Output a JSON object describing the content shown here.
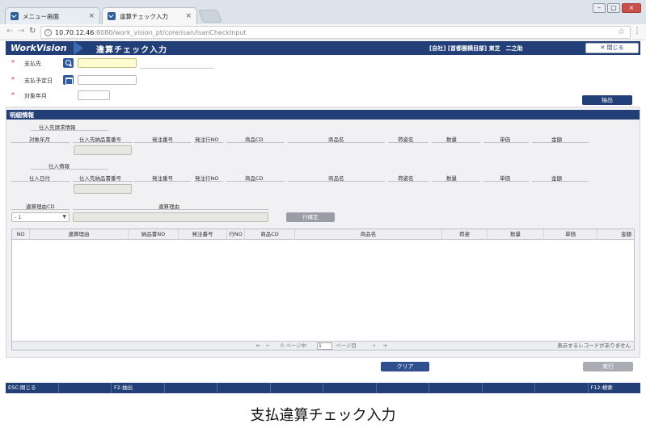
{
  "browser": {
    "tabs": [
      {
        "label": "メニュー画面",
        "active": false
      },
      {
        "label": "違算チェック入力",
        "active": true
      }
    ],
    "url_host": "10.70.12.46",
    "url_rest": ":8080/work_vision_pt/core/isan/IsanCheckInput",
    "window_buttons": [
      "–",
      "□",
      "×"
    ]
  },
  "header": {
    "logo": "WorkVision",
    "title": "違算チェック入力",
    "user": "[自社] [首都圏横目部] 東芝　二之助",
    "close_label": "✕ 閉じる"
  },
  "search": {
    "payee_label": "支払先",
    "payment_date_label": "支払予定日",
    "target_month_label": "対象年月",
    "required_mark": "*",
    "extract_label": "抽出"
  },
  "detail": {
    "title": "明細情報",
    "billing_section": "仕入先請求情報",
    "purchase_section": "仕入情報",
    "billing_columns": [
      "対象年月",
      "仕入先納品書番号",
      "発注番号",
      "発注行NO",
      "商品CD",
      "商品名",
      "荷姿名",
      "数量",
      "単価",
      "金額"
    ],
    "purchase_columns": [
      "仕入日付",
      "仕入先納品書番号",
      "発注番号",
      "発注行NO",
      "商品CD",
      "商品名",
      "荷姿名",
      "数量",
      "単価",
      "金額"
    ],
    "reason_cd_label": "違算理由CD",
    "reason_label": "違算理由",
    "reason_select_value": "- 1",
    "row_confirm_label": "行確定"
  },
  "grid": {
    "columns": [
      "NO",
      "違算理由",
      "納品書NO",
      "発注番号",
      "行NO",
      "商品CD",
      "商品名",
      "荷姿",
      "数量",
      "単価",
      "金額"
    ],
    "pager": {
      "first": "⇤",
      "prev": "⇠",
      "page_of": "0 ページ中",
      "page_value": "1",
      "page_label": "ページ目",
      "next": "⇢",
      "last": "⇥",
      "empty_message": "表示するレコードがありません"
    }
  },
  "actions": {
    "clear_label": "クリア",
    "execute_label": "実行"
  },
  "fkeys": [
    "ESC:閉じる",
    "",
    "F2:抽出",
    "",
    "",
    "",
    "",
    "",
    "",
    "",
    "",
    "F12:検索"
  ],
  "caption": "支払違算チェック入力"
}
